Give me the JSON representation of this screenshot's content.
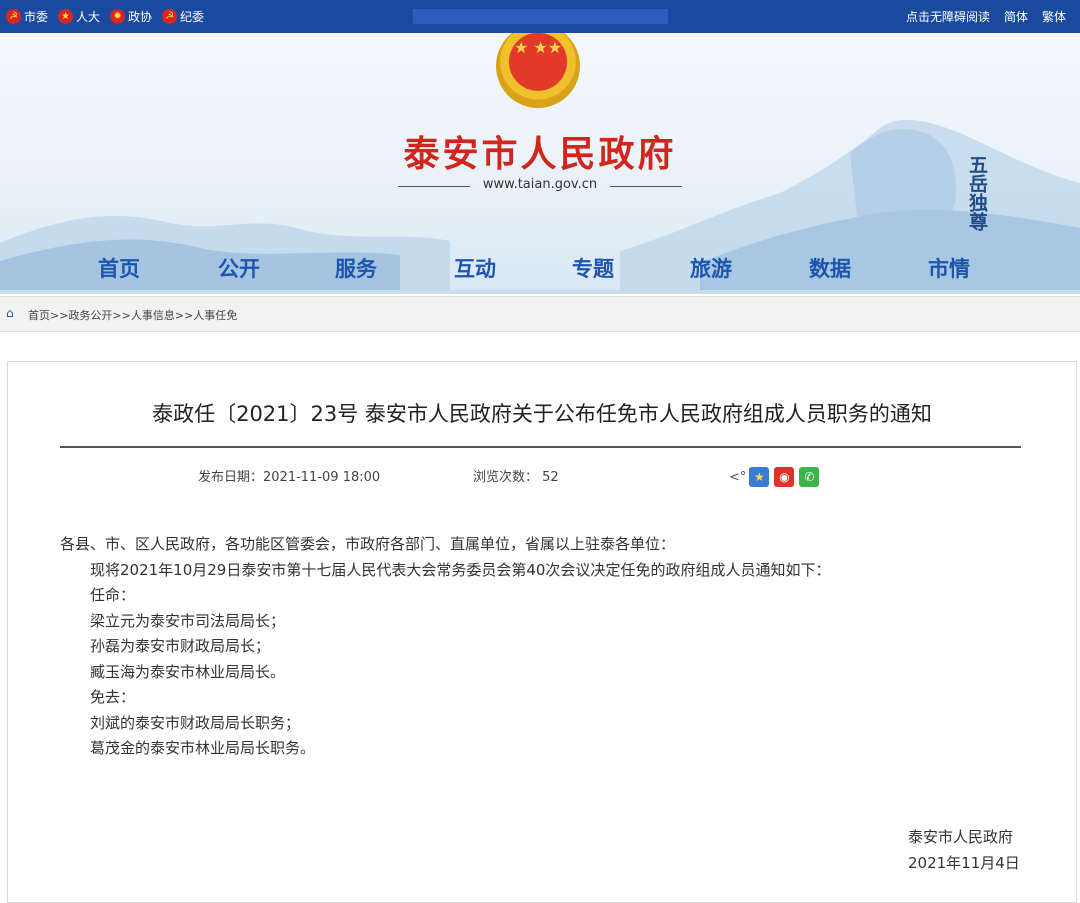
{
  "topbar": {
    "links": [
      {
        "label": "市委",
        "icon": "party-emblem-icon"
      },
      {
        "label": "人大",
        "icon": "national-emblem-icon"
      },
      {
        "label": "政协",
        "icon": "cppcc-emblem-icon"
      },
      {
        "label": "纪委",
        "icon": "party-emblem-icon"
      }
    ],
    "accessibility": "点击无障碍阅读",
    "simplified": "简体",
    "traditional": "繁体"
  },
  "banner": {
    "title": "泰安市人民政府",
    "url": "www.taian.gov.cn",
    "mountain_text": "五岳独尊"
  },
  "nav": [
    "首页",
    "公开",
    "服务",
    "互动",
    "专题",
    "旅游",
    "数据",
    "市情"
  ],
  "breadcrumb": "首页>>政务公开>>人事信息>>人事任免",
  "article": {
    "title": "泰政任〔2021〕23号 泰安市人民政府关于公布任免市人民政府组成人员职务的通知",
    "date_label": "发布日期：",
    "date": "2021-11-09 18:00",
    "views_label": "浏览次数：",
    "views": "52",
    "salutation": "各县、市、区人民政府，各功能区管委会，市政府各部门、直属单位，省属以上驻泰各单位：",
    "intro": "现将2021年10月29日泰安市第十七届人民代表大会常务委员会第40次会议决定任免的政府组成人员通知如下：",
    "appoint_label": "任命：",
    "appointments": [
      "梁立元为泰安市司法局局长；",
      "孙磊为泰安市财政局局长；",
      "臧玉海为泰安市林业局局长。"
    ],
    "remove_label": "免去：",
    "removals": [
      "刘斌的泰安市财政局局长职务；",
      "葛茂金的泰安市林业局局长职务。"
    ],
    "signature": "泰安市人民政府",
    "sign_date": "2021年11月4日"
  },
  "colors": {
    "topbar": "#1a4aa0",
    "title_red": "#d2261c",
    "nav_blue": "#1d55ad"
  }
}
